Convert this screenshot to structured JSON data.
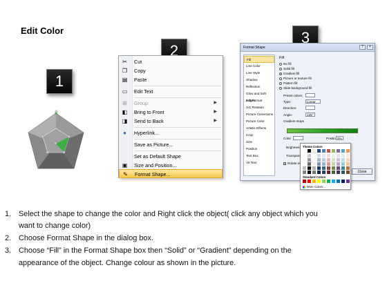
{
  "title": "Edit Color",
  "steps": [
    {
      "label": "1"
    },
    {
      "label": "2"
    },
    {
      "label": "3"
    }
  ],
  "context_menu": {
    "items": [
      {
        "label": "Cut",
        "icon": "scissors-icon",
        "enabled": true
      },
      {
        "label": "Copy",
        "icon": "copy-icon",
        "enabled": true
      },
      {
        "label": "Paste",
        "icon": "paste-icon",
        "enabled": true
      },
      {
        "label": "Edit Text",
        "icon": "edit-text-icon",
        "enabled": true
      },
      {
        "label": "Group",
        "icon": "group-icon",
        "enabled": false,
        "submenu": true
      },
      {
        "label": "Bring to Front",
        "icon": "bring-to-front-icon",
        "enabled": true,
        "submenu": true
      },
      {
        "label": "Send to Back",
        "icon": "send-to-back-icon",
        "enabled": true,
        "submenu": true
      },
      {
        "label": "Hyperlink...",
        "icon": "hyperlink-icon",
        "enabled": true
      },
      {
        "label": "Save as Picture...",
        "icon": "",
        "enabled": true
      },
      {
        "label": "Set as Default Shape",
        "icon": "",
        "enabled": true
      },
      {
        "label": "Size and Position...",
        "icon": "size-position-icon",
        "enabled": true
      },
      {
        "label": "Format Shape...",
        "icon": "format-shape-icon",
        "enabled": true,
        "highlighted": true
      }
    ]
  },
  "format_dialog": {
    "title": "Format Shape",
    "nav": [
      "Fill",
      "Line Color",
      "Line Style",
      "Shadow",
      "Reflection",
      "Glow and Soft Edges",
      "3-D Format",
      "3-D Rotation",
      "Picture Corrections",
      "Picture Color",
      "Artistic Effects",
      "Crop",
      "Size",
      "Position",
      "Text Box",
      "Alt Text"
    ],
    "section": "Fill",
    "fill_options": [
      "No fill",
      "Solid fill",
      "Gradient fill",
      "Picture or texture fill",
      "Pattern fill",
      "Slide background fill"
    ],
    "selected_fill": "Gradient fill",
    "fields": {
      "preset": "Preset colors:",
      "type_label": "Type:",
      "type_value": "Linear",
      "direction_label": "Direction:",
      "angle_label": "Angle:",
      "angle_value": "135°",
      "gradient_stops": "Gradient stops",
      "color_label": "Color",
      "position_label": "Position:",
      "position_value": "0%",
      "brightness_label": "Brightness:",
      "transparency_label": "Transparen",
      "rotate_label": "Rotate w"
    },
    "close_label": "Close",
    "palette": {
      "theme_label": "Theme Colors",
      "standard_label": "Standard Colors",
      "more_label": "More Colors...",
      "theme_top": [
        "#ffffff",
        "#000000",
        "#eeece1",
        "#1f497d",
        "#4f81bd",
        "#c0504d",
        "#9bbb59",
        "#8064a2",
        "#4bacc6",
        "#f79646"
      ],
      "standard": [
        "#c00000",
        "#ff0000",
        "#ffc000",
        "#ffff00",
        "#92d050",
        "#00b050",
        "#00b0f0",
        "#0070c0",
        "#002060",
        "#7030a0"
      ]
    }
  },
  "instructions": [
    {
      "num": "1.",
      "lines": [
        "Select the shape to change the color and Right click the object( click any object which you",
        "want to change color)"
      ]
    },
    {
      "num": "2.",
      "lines": [
        "Choose Format Shape in the dialog box."
      ]
    },
    {
      "num": "3.",
      "lines": [
        "Choose “Fill” in the Format Shape box then “Solid” or “Gradient” depending on the",
        "appearance of the object. Change colour as shown in the picture."
      ]
    }
  ]
}
